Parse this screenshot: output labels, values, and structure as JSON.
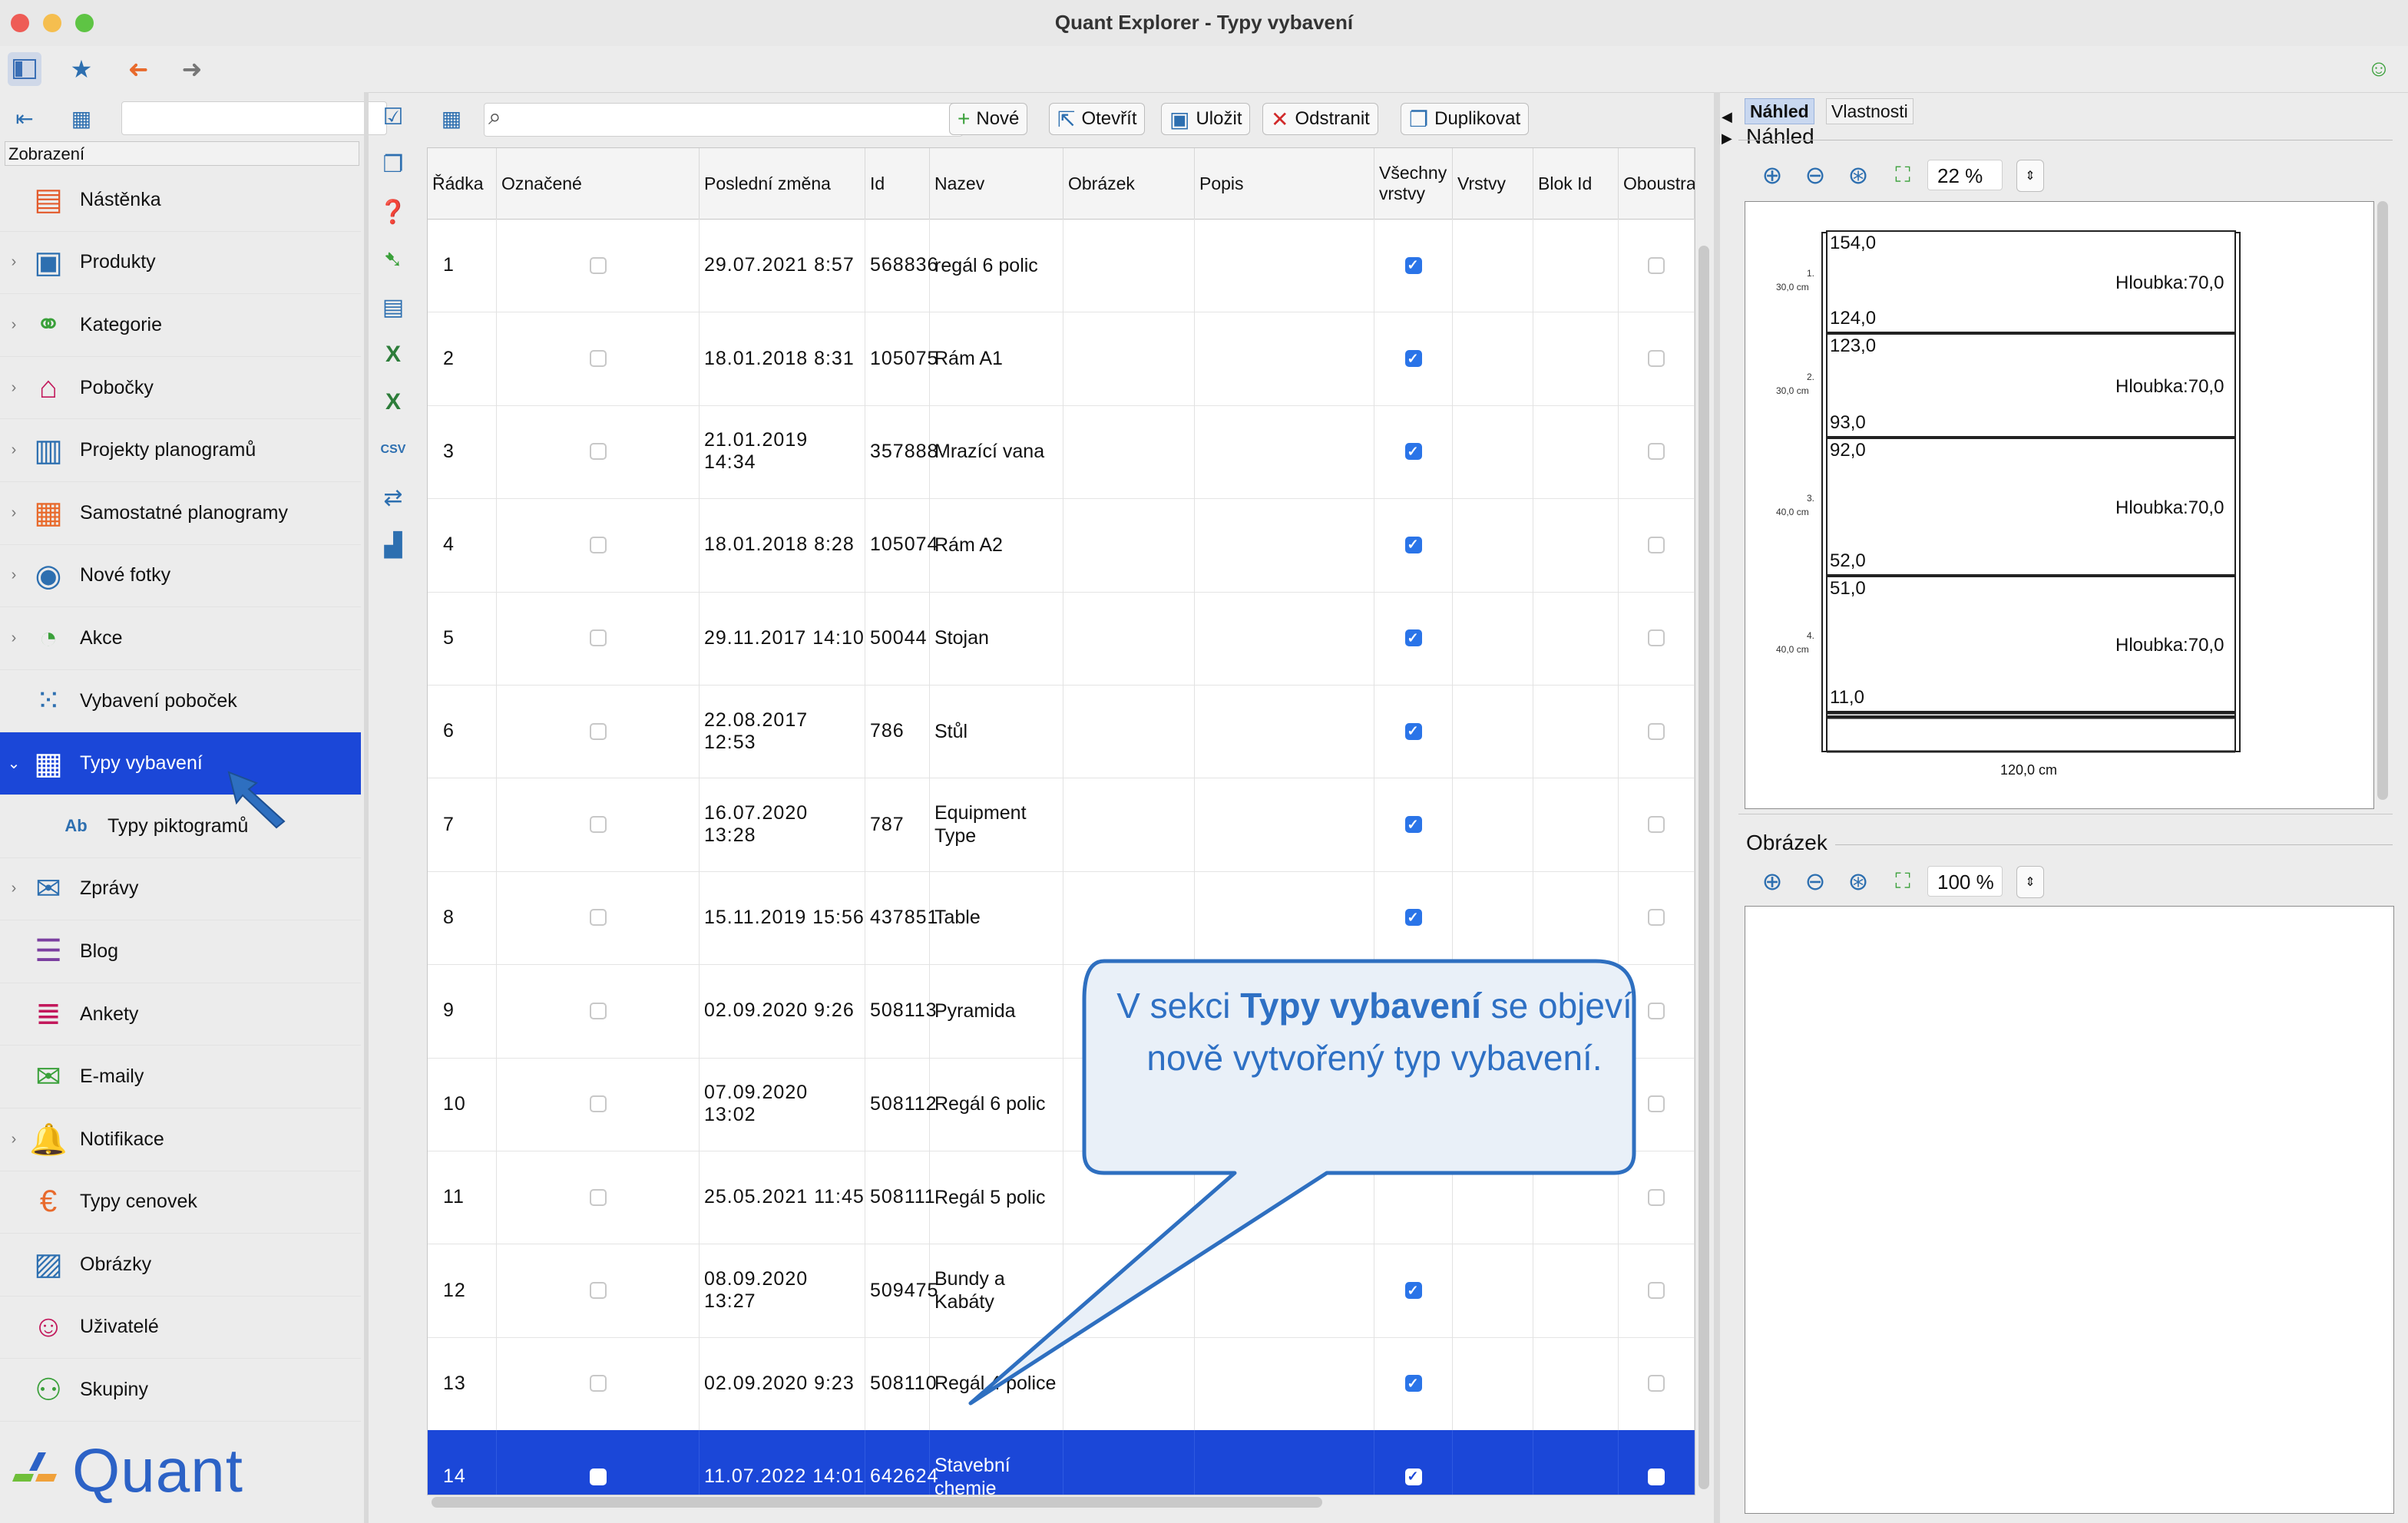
{
  "window": {
    "title": "Quant Explorer - Typy vybavení"
  },
  "sidebar": {
    "search_value": "",
    "header": "Zobrazení",
    "items": [
      {
        "label": "Nástěnka",
        "icon": "dashboard-icon",
        "expandable": false
      },
      {
        "label": "Produkty",
        "icon": "product-icon",
        "expandable": true
      },
      {
        "label": "Kategorie",
        "icon": "category-icon",
        "expandable": true
      },
      {
        "label": "Pobočky",
        "icon": "store-icon",
        "expandable": true
      },
      {
        "label": "Projekty planogramů",
        "icon": "planogram-project-icon",
        "expandable": true
      },
      {
        "label": "Samostatné planogramy",
        "icon": "planogram-icon",
        "expandable": true
      },
      {
        "label": "Nové fotky",
        "icon": "camera-icon",
        "expandable": true
      },
      {
        "label": "Akce",
        "icon": "promo-icon",
        "expandable": true
      },
      {
        "label": "Vybavení poboček",
        "icon": "store-equipment-icon",
        "expandable": false
      },
      {
        "label": "Typy vybavení",
        "icon": "equipment-type-icon",
        "expandable": true,
        "selected": true
      },
      {
        "label": "Typy piktogramů",
        "icon": "pictogram-type-icon",
        "expandable": false,
        "sub": true
      },
      {
        "label": "Zprávy",
        "icon": "messages-icon",
        "expandable": true
      },
      {
        "label": "Blog",
        "icon": "blog-icon",
        "expandable": false
      },
      {
        "label": "Ankety",
        "icon": "survey-icon",
        "expandable": false
      },
      {
        "label": "E-maily",
        "icon": "email-icon",
        "expandable": false
      },
      {
        "label": "Notifikace",
        "icon": "notification-icon",
        "expandable": true
      },
      {
        "label": "Typy cenovek",
        "icon": "price-tag-icon",
        "expandable": false
      },
      {
        "label": "Obrázky",
        "icon": "image-icon",
        "expandable": false
      },
      {
        "label": "Uživatelé",
        "icon": "user-icon",
        "expandable": false
      },
      {
        "label": "Skupiny",
        "icon": "group-icon",
        "expandable": false
      }
    ],
    "logo_text": "Quant"
  },
  "toolbar": {
    "search_value": "",
    "buttons": {
      "new": "Nové",
      "open": "Otevřít",
      "save": "Uložit",
      "delete": "Odstranit",
      "duplicate": "Duplikovat"
    }
  },
  "grid": {
    "columns": [
      "Řádka",
      "Označené",
      "Poslední změna",
      "Id",
      "Nazev",
      "Obrázek",
      "Popis",
      "Všechny vrstvy",
      "Vrstvy",
      "Blok Id",
      "Oboustranr"
    ],
    "rows": [
      {
        "n": "1",
        "marked": false,
        "changed": "29.07.2021 8:57",
        "id": "568836",
        "name": "regál 6 polic",
        "all_layers": true
      },
      {
        "n": "2",
        "marked": false,
        "changed": "18.01.2018 8:31",
        "id": "105075",
        "name": "Rám A1",
        "all_layers": true
      },
      {
        "n": "3",
        "marked": false,
        "changed": "21.01.2019 14:34",
        "id": "357888",
        "name": "Mrazící vana",
        "all_layers": true
      },
      {
        "n": "4",
        "marked": false,
        "changed": "18.01.2018 8:28",
        "id": "105074",
        "name": "Rám A2",
        "all_layers": true
      },
      {
        "n": "5",
        "marked": false,
        "changed": "29.11.2017 14:10",
        "id": "50044",
        "name": "Stojan",
        "all_layers": true
      },
      {
        "n": "6",
        "marked": false,
        "changed": "22.08.2017 12:53",
        "id": "786",
        "name": "Stůl",
        "all_layers": true
      },
      {
        "n": "7",
        "marked": false,
        "changed": "16.07.2020 13:28",
        "id": "787",
        "name": "Equipment Type",
        "all_layers": true
      },
      {
        "n": "8",
        "marked": false,
        "changed": "15.11.2019 15:56",
        "id": "437851",
        "name": "Table",
        "all_layers": true
      },
      {
        "n": "9",
        "marked": false,
        "changed": "02.09.2020 9:26",
        "id": "508113",
        "name": "Pyramida",
        "all_layers": null
      },
      {
        "n": "10",
        "marked": false,
        "changed": "07.09.2020 13:02",
        "id": "508112",
        "name": "Regál 6 polic",
        "all_layers": null
      },
      {
        "n": "11",
        "marked": false,
        "changed": "25.05.2021 11:45",
        "id": "508111",
        "name": "Regál 5 polic",
        "all_layers": null
      },
      {
        "n": "12",
        "marked": false,
        "changed": "08.09.2020 13:27",
        "id": "509475",
        "name": "Bundy a Kabáty",
        "all_layers": true
      },
      {
        "n": "13",
        "marked": false,
        "changed": "02.09.2020 9:23",
        "id": "508110",
        "name": "Regál 4 police",
        "all_layers": true
      },
      {
        "n": "14",
        "marked": false,
        "changed": "11.07.2022 14:01",
        "id": "642624",
        "name": "Stavební chemie",
        "all_layers": true,
        "selected": true
      }
    ]
  },
  "right_panel": {
    "tabs": [
      "Náhled",
      "Vlastnosti"
    ],
    "preview": {
      "title": "Náhled",
      "zoom": "22 %",
      "shelves": [
        {
          "top": "154,0",
          "bottom": "124,0",
          "depth": "Hloubka:70,0",
          "num": "1.",
          "height": "30,0 cm"
        },
        {
          "top": "123,0",
          "bottom": "93,0",
          "depth": "Hloubka:70,0",
          "num": "2.",
          "height": "30,0 cm"
        },
        {
          "top": "92,0",
          "bottom": "52,0",
          "depth": "Hloubka:70,0",
          "num": "3.",
          "height": "40,0 cm"
        },
        {
          "top": "51,0",
          "bottom": "11,0",
          "depth": "Hloubka:70,0",
          "num": "4.",
          "height": "40,0 cm"
        }
      ],
      "width_label": "120,0 cm"
    },
    "image": {
      "title": "Obrázek",
      "zoom": "100 %"
    }
  },
  "callout": {
    "before": "V sekci ",
    "bold": "Typy vybavení",
    "after": " se objeví nově vytvořený typ vybavení."
  },
  "colors": {
    "selection": "#1b47d8",
    "accent": "#2d6fb0",
    "callout_text": "#2e70c4",
    "callout_fill": "#e9f0f8"
  }
}
